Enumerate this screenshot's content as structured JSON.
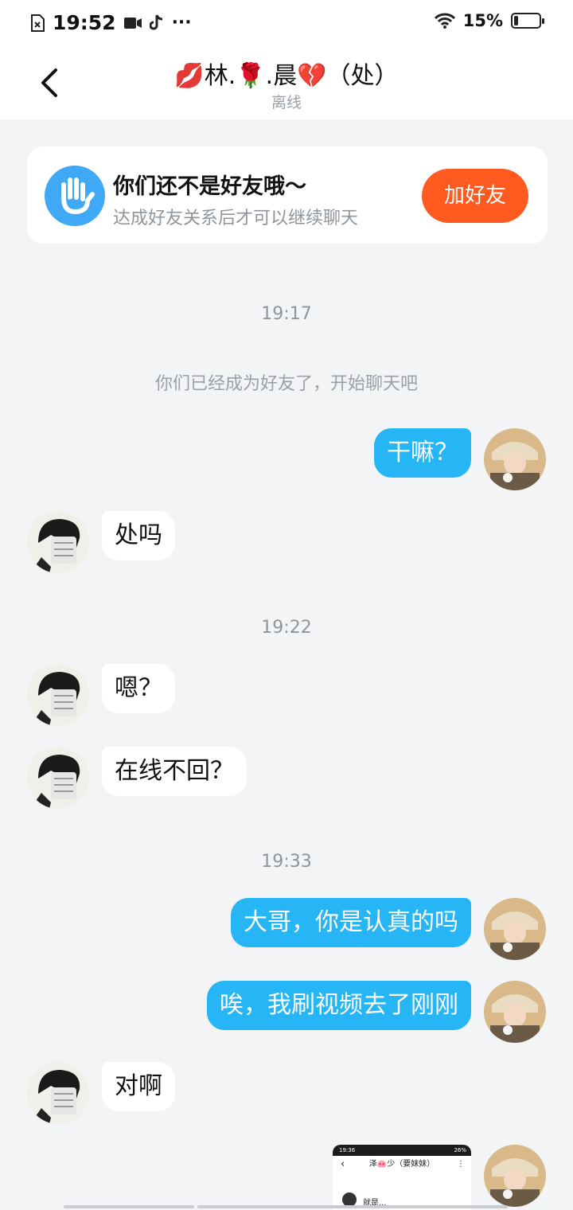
{
  "status_bar": {
    "time": "19:52",
    "battery": "15%",
    "battery_level": 0.15,
    "icons": [
      "sim-error-icon",
      "video-icon",
      "tiktok-icon",
      "more-icon",
      "wifi-icon",
      "battery-icon"
    ]
  },
  "header": {
    "title": "💋林.🌹.晨💔（处）",
    "status": "离线",
    "back_icon": "chevron-left-icon"
  },
  "friend_card": {
    "title": "你们还不是好友哦～",
    "subtitle": "达成好友关系后才可以继续聊天",
    "button": "加好友",
    "icon": "hand-icon",
    "colors": {
      "icon_bg": "#3fa9f5",
      "button_bg": "#ff5a1f"
    }
  },
  "colors": {
    "outgoing_bubble": "#26b5f5",
    "incoming_bubble": "#ffffff",
    "background": "#f2f4f5"
  },
  "chat": {
    "ts1": "19:17",
    "system1": "你们已经成为好友了，开始聊天吧",
    "m1": "干嘛？",
    "m2": "处吗",
    "ts2": "19:22",
    "m3": "嗯？",
    "m4": "在线不回？",
    "ts3": "19:33",
    "m5": "大哥，你是认真的吗",
    "m6": "唉，我刷视频去了刚刚",
    "m7": "对啊"
  },
  "thumbnail": {
    "time": "19:36",
    "battery": "26%",
    "title": "泽🐽少（要妹妹）",
    "message": "就是..."
  }
}
